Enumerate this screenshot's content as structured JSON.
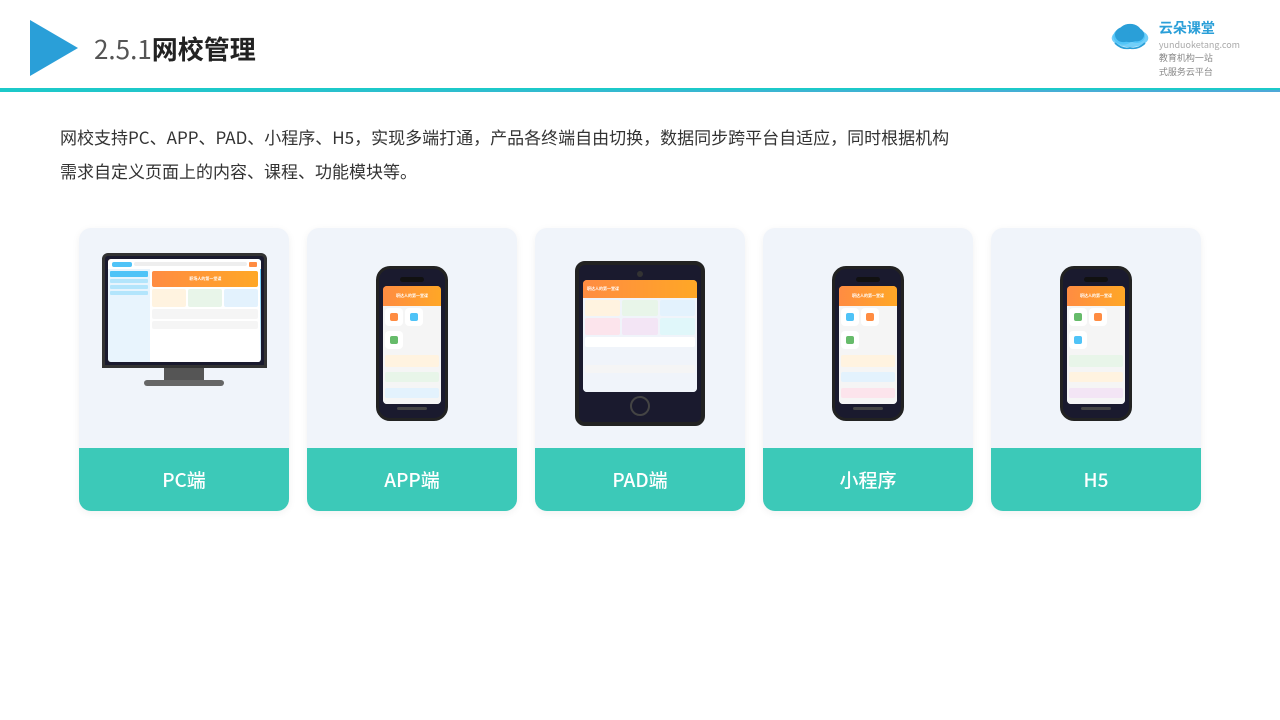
{
  "header": {
    "title": "2.5.1网校管理",
    "title_prefix": "2.5.1",
    "title_main": "网校管理"
  },
  "brand": {
    "name": "云朵课堂",
    "url": "yunduoketang.com",
    "tagline_line1": "教育机构一站",
    "tagline_line2": "式服务云平台"
  },
  "description": {
    "text": "网校支持PC、APP、PAD、小程序、H5，实现多端打通，产品各终端自由切换，数据同步跨平台自适应，同时根据机构需求自定义页面上的内容、课程、功能模块等。"
  },
  "cards": [
    {
      "id": "pc",
      "label": "PC端",
      "type": "pc"
    },
    {
      "id": "app",
      "label": "APP端",
      "type": "mobile"
    },
    {
      "id": "pad",
      "label": "PAD端",
      "type": "tablet"
    },
    {
      "id": "miniapp",
      "label": "小程序",
      "type": "mobile"
    },
    {
      "id": "h5",
      "label": "H5",
      "type": "mobile"
    }
  ],
  "colors": {
    "accent": "#3cc9b8",
    "header_line": "#1cc9c9",
    "brand_blue": "#2a9fd8",
    "card_bg": "#f0f4fa"
  }
}
